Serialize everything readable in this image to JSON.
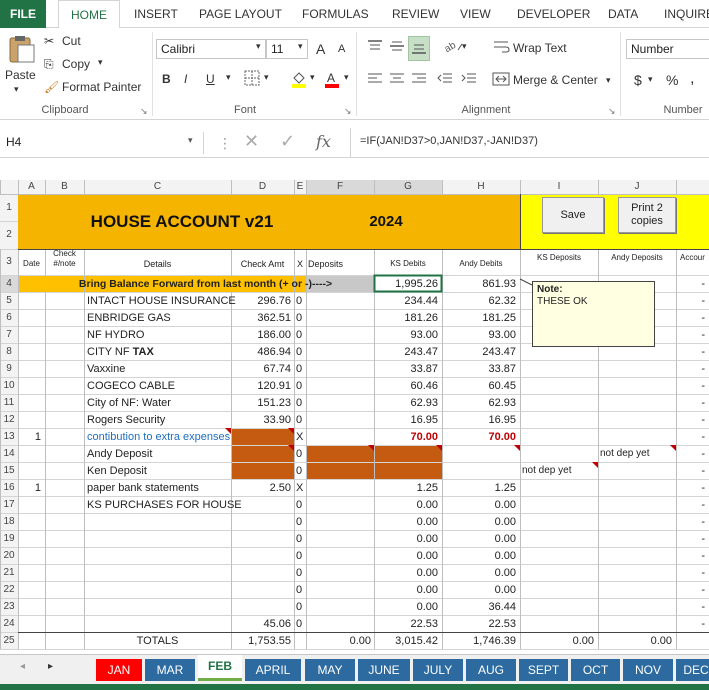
{
  "ribbon_tabs": [
    "FILE",
    "HOME",
    "INSERT",
    "PAGE LAYOUT",
    "FORMULAS",
    "REVIEW",
    "VIEW",
    "DEVELOPER",
    "DATA",
    "INQUIRE"
  ],
  "clipboard": {
    "paste": "Paste",
    "cut": "Cut",
    "copy": "Copy",
    "format_painter": "Format Painter",
    "label": "Clipboard"
  },
  "font": {
    "name": "Calibri",
    "size": "11",
    "grow": "A",
    "shrink": "A",
    "bold": "B",
    "italic": "I",
    "underline": "U",
    "label": "Font"
  },
  "alignment": {
    "wrap": "Wrap Text",
    "merge": "Merge & Center",
    "label": "Alignment"
  },
  "number": {
    "format": "Number",
    "currency": "$",
    "percent": "%",
    "comma": ",",
    "label": "Number"
  },
  "formula_bar": {
    "name_box": "H4",
    "formula": "=IF(JAN!D37>0,JAN!D37,-JAN!D37)",
    "fx": "fx"
  },
  "columns": [
    "A",
    "B",
    "C",
    "D",
    "E",
    "F",
    "G",
    "H",
    "I",
    "J"
  ],
  "title": "HOUSE ACCOUNT v21",
  "year": "2024",
  "buttons": {
    "save": "Save",
    "print": "Print 2 copies"
  },
  "headers": {
    "date": "Date",
    "check": "Check #/note",
    "details": "Details",
    "check_amt": "Check Amt",
    "x": "X",
    "deposits": "Deposits",
    "ks_debits": "KS Debits",
    "andy_debits": "Andy Debits",
    "ks_deposits": "KS Deposits",
    "andy_deposits": "Andy Deposits",
    "account": "Accour"
  },
  "balance_forward": {
    "label": "Bring Balance Forward from last month (+ or -)---->",
    "ks": "1,995.26",
    "andy": "861.93"
  },
  "note": {
    "title": "Note:",
    "text": "THESE OK"
  },
  "rows": [
    {
      "r": "5",
      "a": "",
      "d": "INTACT HOUSE INSURANCE",
      "amt": "296.76",
      "x": "0",
      "ks": "234.44",
      "andy": "62.32",
      "i": "",
      "j": ""
    },
    {
      "r": "6",
      "a": "",
      "d": "ENBRIDGE GAS",
      "amt": "362.51",
      "x": "0",
      "ks": "181.26",
      "andy": "181.25",
      "i": "",
      "j": ""
    },
    {
      "r": "7",
      "a": "",
      "d": "NF HYDRO",
      "amt": "186.00",
      "x": "0",
      "ks": "93.00",
      "andy": "93.00",
      "i": "",
      "j": ""
    },
    {
      "r": "8",
      "a": "",
      "d": "CITY NF TAX",
      "amt": "486.94",
      "x": "0",
      "ks": "243.47",
      "andy": "243.47",
      "i": "",
      "j": ""
    },
    {
      "r": "9",
      "a": "",
      "d": "Vaxxine",
      "amt": "67.74",
      "x": "0",
      "ks": "33.87",
      "andy": "33.87",
      "i": "",
      "j": ""
    },
    {
      "r": "10",
      "a": "",
      "d": "COGECO CABLE",
      "amt": "120.91",
      "x": "0",
      "ks": "60.46",
      "andy": "60.45",
      "i": "",
      "j": ""
    },
    {
      "r": "11",
      "a": "",
      "d": "City of NF: Water",
      "amt": "151.23",
      "x": "0",
      "ks": "62.93",
      "andy": "62.93",
      "i": "",
      "j": ""
    },
    {
      "r": "12",
      "a": "",
      "d": "Rogers Security",
      "amt": "33.90",
      "x": "0",
      "ks": "16.95",
      "andy": "16.95",
      "i": "",
      "j": ""
    },
    {
      "r": "13",
      "a": "1",
      "d": "contibution to extra expenses",
      "amt": "",
      "x": "X",
      "ks": "70.00",
      "andy": "70.00",
      "i": "",
      "j": ""
    },
    {
      "r": "14",
      "a": "",
      "d": "Andy Deposit",
      "amt": "",
      "x": "0",
      "ks": "",
      "andy": "",
      "i": "",
      "j": "not dep yet"
    },
    {
      "r": "15",
      "a": "",
      "d": "Ken Deposit",
      "amt": "",
      "x": "0",
      "ks": "",
      "andy": "",
      "i": "not dep yet",
      "j": ""
    },
    {
      "r": "16",
      "a": "1",
      "d": "paper bank statements",
      "amt": "2.50",
      "x": "X",
      "ks": "1.25",
      "andy": "1.25",
      "i": "",
      "j": ""
    },
    {
      "r": "17",
      "a": "",
      "d": "KS PURCHASES FOR HOUSE",
      "amt": "",
      "x": "0",
      "ks": "0.00",
      "andy": "0.00",
      "i": "",
      "j": ""
    },
    {
      "r": "18",
      "a": "",
      "d": "",
      "amt": "",
      "x": "0",
      "ks": "0.00",
      "andy": "0.00",
      "i": "",
      "j": ""
    },
    {
      "r": "19",
      "a": "",
      "d": "",
      "amt": "",
      "x": "0",
      "ks": "0.00",
      "andy": "0.00",
      "i": "",
      "j": ""
    },
    {
      "r": "20",
      "a": "",
      "d": "",
      "amt": "",
      "x": "0",
      "ks": "0.00",
      "andy": "0.00",
      "i": "",
      "j": ""
    },
    {
      "r": "21",
      "a": "",
      "d": "",
      "amt": "",
      "x": "0",
      "ks": "0.00",
      "andy": "0.00",
      "i": "",
      "j": ""
    },
    {
      "r": "22",
      "a": "",
      "d": "",
      "amt": "",
      "x": "0",
      "ks": "0.00",
      "andy": "0.00",
      "i": "",
      "j": ""
    },
    {
      "r": "23",
      "a": "",
      "d": "",
      "amt": "",
      "x": "0",
      "ks": "0.00",
      "andy": "36.44",
      "i": "",
      "j": ""
    },
    {
      "r": "24",
      "a": "",
      "d": "",
      "amt": "45.06",
      "x": "0",
      "ks": "22.53",
      "andy": "22.53",
      "i": "",
      "j": ""
    }
  ],
  "dash": "-",
  "totals": {
    "label": "TOTALS",
    "amt": "1,753.55",
    "deposits": "0.00",
    "ks": "3,015.42",
    "andy": "1,746.39",
    "ks_dep": "0.00",
    "andy_dep": "0.00"
  },
  "sheet_tabs": [
    "JAN",
    "MAR",
    "FEB",
    "APRIL",
    "MAY",
    "JUNE",
    "JULY",
    "AUG",
    "SEPT",
    "OCT",
    "NOV",
    "DEC"
  ],
  "colors": {
    "title_bg": "#f4b400",
    "orange_cell": "#c55a11",
    "balance_bg": "#ffc000",
    "buttons_bg": "#ffff00",
    "excel_green": "#217346",
    "tab_blue": "#2c6aa0",
    "tab_red": "#ff0000",
    "tab_active": "#70ad47",
    "red_text": "#c00000",
    "blue_text": "#1f6fbf"
  }
}
